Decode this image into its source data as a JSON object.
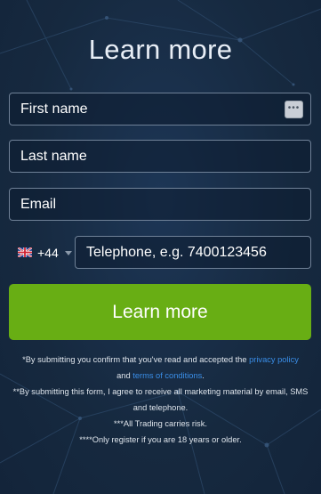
{
  "form": {
    "title": "Learn more",
    "first_name_placeholder": "First name",
    "last_name_placeholder": "Last name",
    "email_placeholder": "Email",
    "country_code": "+44",
    "country_flag": "gb-flag-icon",
    "phone_placeholder": "Telephone, e.g. 7400123456",
    "submit_label": "Learn more",
    "autofill_icon": "autofill-dots-icon"
  },
  "disclaimer": {
    "line1_pre": "*By submitting you confirm that you've read and accepted the ",
    "privacy_link": "privacy policy",
    "line1_mid": "and ",
    "terms_link": "terms of conditions",
    "line1_end": ".",
    "line2": "**By submitting this form, I agree to receive all marketing material by email, SMS and telephone.",
    "line3": "***All Trading carries risk.",
    "line4": "****Only register if you are 18 years or older."
  },
  "colors": {
    "background": "#172c45",
    "button": "#68ae14",
    "link": "#3a8ee8",
    "field_border": "#6f8197"
  }
}
